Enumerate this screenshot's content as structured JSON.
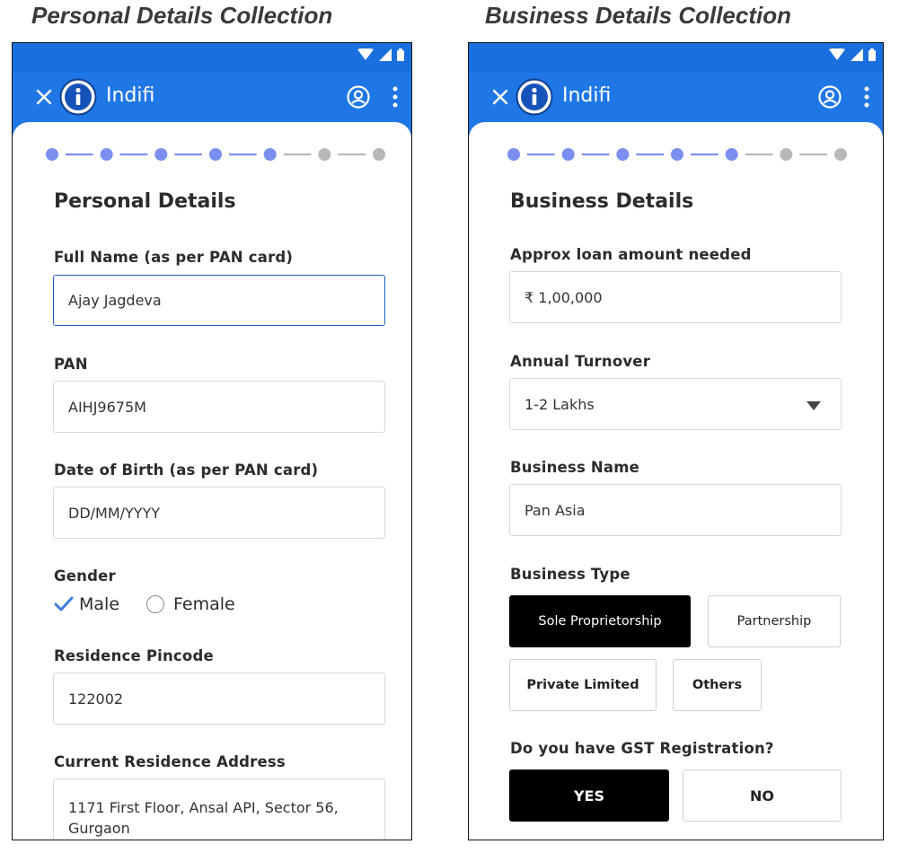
{
  "captions": {
    "left": "Personal Details Collection",
    "right": "Business Details Collection"
  },
  "app": {
    "title": "Indifi",
    "icons": [
      "wifi-icon",
      "signal-icon",
      "battery-icon",
      "close-icon",
      "indifi-logo-icon",
      "account-icon",
      "more-vert-icon"
    ]
  },
  "colors": {
    "brand": "#1f77e6",
    "step_active": "#7b8ff0",
    "step_inactive": "#b8b8b8",
    "selected": "#000000"
  },
  "stepper": {
    "total_steps": 7,
    "completed_steps": 5
  },
  "personal": {
    "section_title": "Personal Details",
    "full_name_label": "Full Name (as per PAN card)",
    "full_name_value": "Ajay Jagdeva",
    "pan_label": "PAN",
    "pan_value": "AIHJ9675M",
    "dob_label": "Date of Birth (as per PAN card)",
    "dob_placeholder": "DD/MM/YYYY",
    "gender_label": "Gender",
    "gender_male": "Male",
    "gender_female": "Female",
    "gender_selected": "Male",
    "pincode_label": "Residence Pincode",
    "pincode_value": "122002",
    "address_label": "Current Residence Address",
    "address_line1": "1171 First Floor, Ansal API, Sector 56,",
    "address_line2": "Gurgaon"
  },
  "business": {
    "section_title": "Business Details",
    "loan_label": "Approx loan amount needed",
    "loan_value": "₹ 1,00,000",
    "turnover_label": "Annual Turnover",
    "turnover_value": "1-2 Lakhs",
    "name_label": "Business Name",
    "name_value": "Pan Asia",
    "type_label": "Business Type",
    "type_options": [
      "Sole Proprietorship",
      "Partnership",
      "Private Limited",
      "Others"
    ],
    "type_selected": "Sole Proprietorship",
    "gst_label": "Do you have GST Registration?",
    "gst_yes": "YES",
    "gst_no": "NO",
    "gst_selected": "YES"
  }
}
